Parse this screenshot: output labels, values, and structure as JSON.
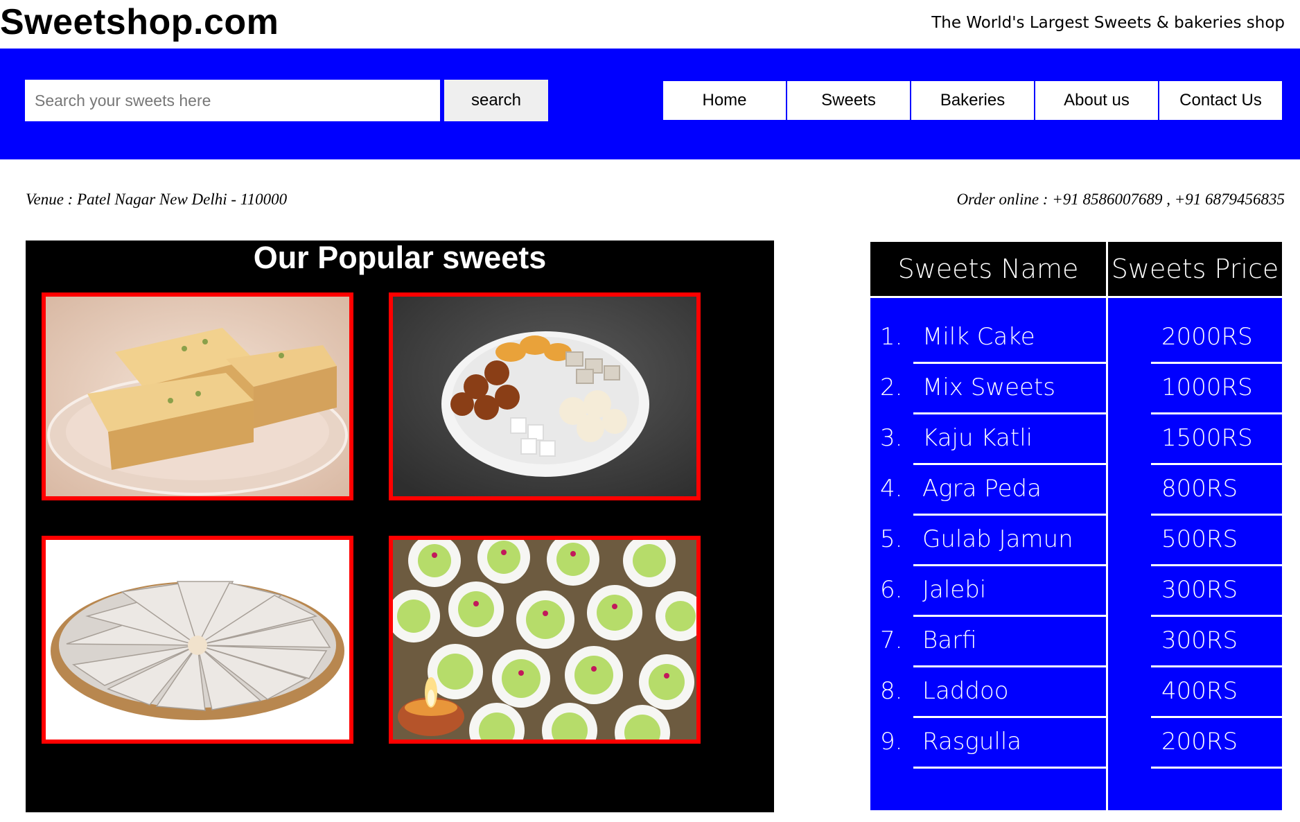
{
  "header": {
    "logo": "Sweetshop.com",
    "tagline": "The World's Largest Sweets & bakeries shop"
  },
  "search": {
    "placeholder": "Search your sweets here",
    "value": "",
    "button_label": "search"
  },
  "nav": {
    "items": [
      {
        "label": "Home"
      },
      {
        "label": "Sweets"
      },
      {
        "label": "Bakeries"
      },
      {
        "label": "About us"
      },
      {
        "label": "Contact Us"
      }
    ]
  },
  "info": {
    "venue": "Venue : Patel Nagar New Delhi - 110000",
    "order": "Order online : +91 8586007689 , +91 6879456835"
  },
  "gallery": {
    "title": "Our Popular sweets",
    "photos": [
      {
        "icon": "milk-cake-photo"
      },
      {
        "icon": "mixed-sweets-plate-photo"
      },
      {
        "icon": "kaju-katli-platter-photo"
      },
      {
        "icon": "stuffed-sweets-with-diya-photo"
      }
    ],
    "border_color": "#ff0000"
  },
  "price_table": {
    "headers": [
      "Sweets Name",
      "Sweets Price"
    ],
    "rows": [
      {
        "num": "1.",
        "name": "Milk Cake",
        "price": "2000RS"
      },
      {
        "num": "2.",
        "name": "Mix Sweets",
        "price": "1000RS"
      },
      {
        "num": "3.",
        "name": "Kaju Katli",
        "price": "1500RS"
      },
      {
        "num": "4.",
        "name": "Agra Peda",
        "price": "800RS"
      },
      {
        "num": "5.",
        "name": "Gulab Jamun",
        "price": "500RS"
      },
      {
        "num": "6.",
        "name": "Jalebi",
        "price": "300RS"
      },
      {
        "num": "7.",
        "name": "Barfi",
        "price": "300RS"
      },
      {
        "num": "8.",
        "name": "Laddoo",
        "price": "400RS"
      },
      {
        "num": "9.",
        "name": "Rasgulla",
        "price": "200RS"
      }
    ]
  },
  "colors": {
    "nav_band": "#0000ff",
    "table_body": "#0000ff",
    "table_head": "#000000",
    "gallery_bg": "#000000"
  }
}
